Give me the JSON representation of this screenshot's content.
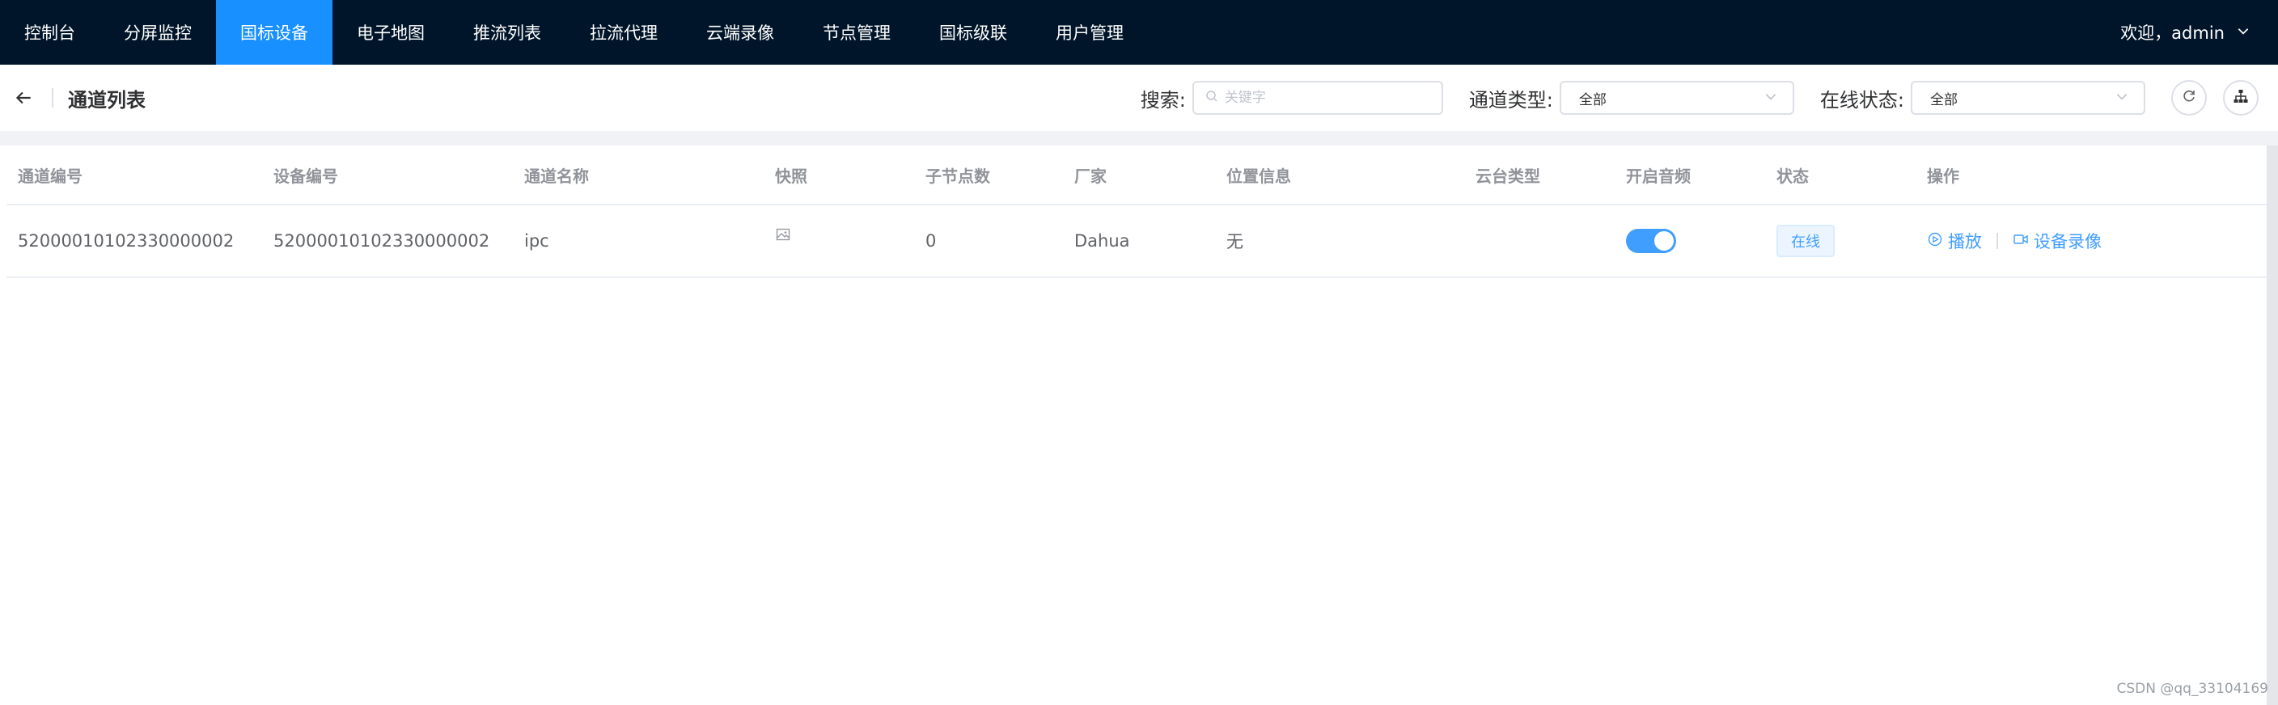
{
  "nav": {
    "items": [
      {
        "label": "控制台",
        "name": "nav-item-console"
      },
      {
        "label": "分屏监控",
        "name": "nav-item-split-monitor"
      },
      {
        "label": "国标设备",
        "name": "nav-item-gb-devices"
      },
      {
        "label": "电子地图",
        "name": "nav-item-map"
      },
      {
        "label": "推流列表",
        "name": "nav-item-push-list"
      },
      {
        "label": "拉流代理",
        "name": "nav-item-pull-proxy"
      },
      {
        "label": "云端录像",
        "name": "nav-item-cloud-record"
      },
      {
        "label": "节点管理",
        "name": "nav-item-node-manage"
      },
      {
        "label": "国标级联",
        "name": "nav-item-gb-cascade"
      },
      {
        "label": "用户管理",
        "name": "nav-item-user-manage"
      }
    ],
    "active_index": 2,
    "user_greeting": "欢迎，admin"
  },
  "header": {
    "title": "通道列表",
    "search_label": "搜索:",
    "search_placeholder": "关键字",
    "search_value": "",
    "channel_type_label": "通道类型:",
    "channel_type_value": "全部",
    "online_status_label": "在线状态:",
    "online_status_value": "全部"
  },
  "table": {
    "columns": [
      "通道编号",
      "设备编号",
      "通道名称",
      "快照",
      "子节点数",
      "厂家",
      "位置信息",
      "云台类型",
      "开启音频",
      "状态",
      "操作"
    ],
    "rows": [
      {
        "channel_id": "52000010102330000002",
        "device_id": "52000010102330000002",
        "channel_name": "ipc",
        "snapshot": "image-icon",
        "sub_count": "0",
        "manufacturer": "Dahua",
        "location": "无",
        "ptz_type": "",
        "audio_enabled": true,
        "status": "在线",
        "actions": {
          "play": "播放",
          "record": "设备录像"
        }
      }
    ]
  },
  "watermark": "CSDN @qq_33104169",
  "colors": {
    "topbar": "#001529",
    "active_nav": "#1890ff",
    "primary": "#409eff"
  }
}
